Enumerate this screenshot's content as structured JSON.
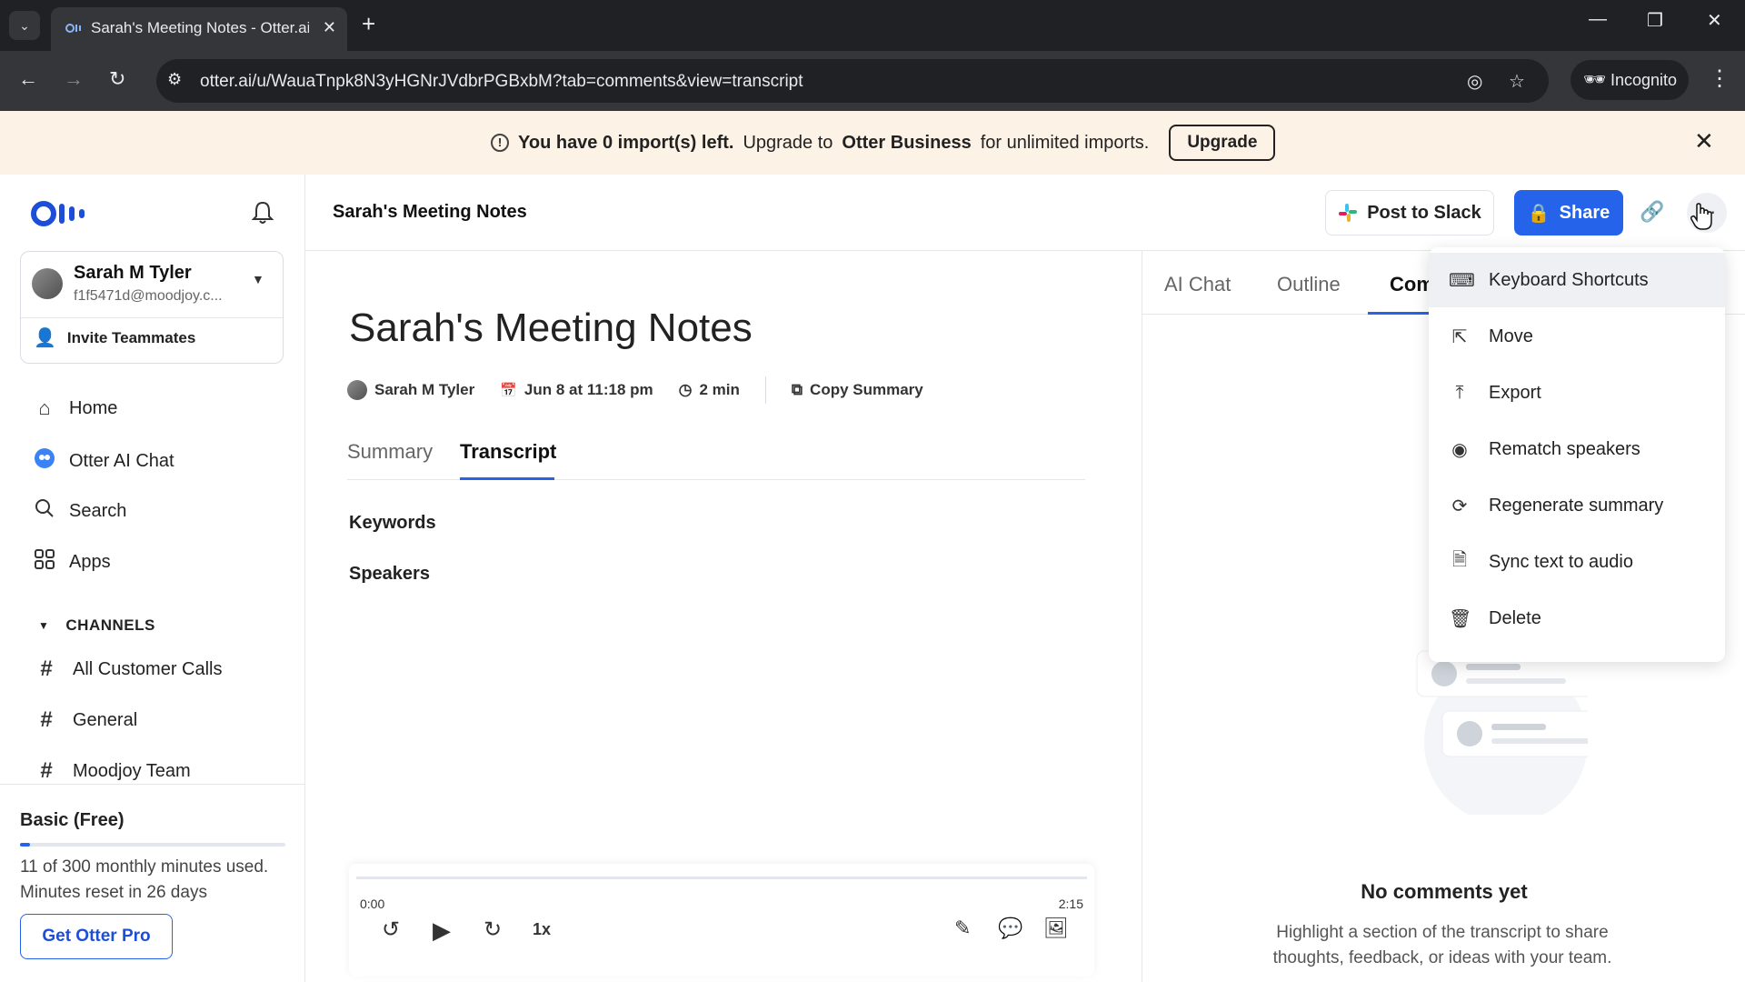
{
  "browser": {
    "tab_title": "Sarah's Meeting Notes - Otter.ai",
    "url": "otter.ai/u/WauaTnpk8N3yHGNrJVdbrPGBxbM?tab=comments&view=transcript",
    "incognito_label": "Incognito"
  },
  "banner": {
    "part1": "You have 0 import(s) left.",
    "part2": "Upgrade to",
    "part3": "Otter Business",
    "part4": "for unlimited imports.",
    "upgrade_label": "Upgrade"
  },
  "sidebar": {
    "account": {
      "name": "Sarah M Tyler",
      "email": "f1f5471d@moodjoy.c..."
    },
    "invite_label": "Invite Teammates",
    "nav": [
      {
        "label": "Home",
        "icon": "home-icon"
      },
      {
        "label": "Otter AI Chat",
        "icon": "otter-ai-chat-icon"
      },
      {
        "label": "Search",
        "icon": "search-icon"
      },
      {
        "label": "Apps",
        "icon": "apps-icon"
      }
    ],
    "channels_label": "CHANNELS",
    "channels": [
      "All Customer Calls",
      "General",
      "Moodjoy Team"
    ],
    "plan": {
      "title": "Basic (Free)",
      "used_text": "11 of 300 monthly minutes used.",
      "reset_text": "Minutes reset in 26 days",
      "usage_fraction": 0.037,
      "cta_label": "Get Otter Pro"
    }
  },
  "header": {
    "title": "Sarah's Meeting Notes",
    "post_to_slack_label": "Post to Slack",
    "share_label": "Share"
  },
  "document": {
    "title": "Sarah's Meeting Notes",
    "meta": {
      "author": "Sarah M Tyler",
      "date": "Jun 8 at 11:18 pm",
      "duration": "2 min",
      "copy_summary": "Copy Summary"
    },
    "tabs": [
      "Summary",
      "Transcript"
    ],
    "active_tab": "Transcript",
    "sections": [
      "Keywords",
      "Speakers"
    ]
  },
  "player": {
    "current_time": "0:00",
    "total_time": "2:15",
    "speed": "1x",
    "progress_fraction": 0
  },
  "right_panel": {
    "tabs": [
      "AI Chat",
      "Outline",
      "Com"
    ],
    "active_tab": "Com",
    "empty_title": "No comments yet",
    "empty_line1": "Highlight a section of the transcript to share",
    "empty_line2": "thoughts, feedback, or ideas with your team."
  },
  "menu": {
    "items": [
      {
        "label": "Keyboard Shortcuts",
        "icon": "keyboard-icon"
      },
      {
        "label": "Move",
        "icon": "move-icon"
      },
      {
        "label": "Export",
        "icon": "export-icon"
      },
      {
        "label": "Rematch speakers",
        "icon": "rematch-speakers-icon"
      },
      {
        "label": "Regenerate summary",
        "icon": "regenerate-icon"
      },
      {
        "label": "Sync text to audio",
        "icon": "sync-audio-icon"
      },
      {
        "label": "Delete",
        "icon": "trash-icon"
      }
    ],
    "highlighted_item": "Keyboard Shortcuts"
  },
  "colors": {
    "accent": "#2563eb",
    "banner_bg": "#fdf2e6",
    "chrome_dark": "#202124"
  }
}
